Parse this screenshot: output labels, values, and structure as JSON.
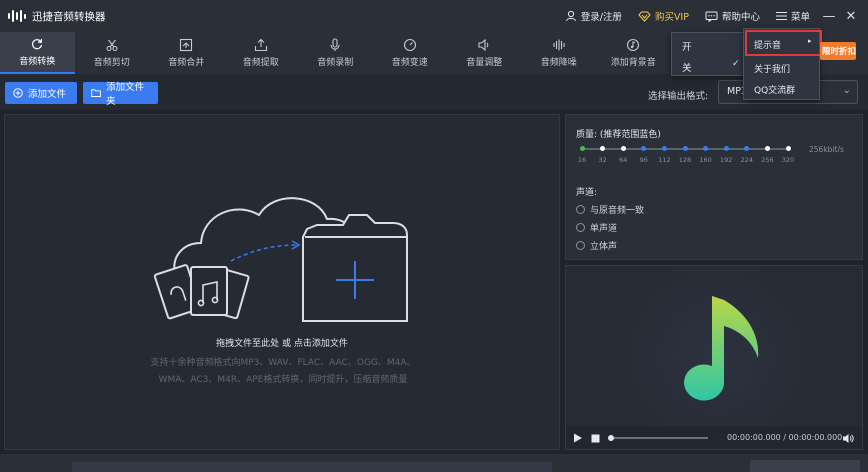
{
  "app": {
    "title": "迅捷音频转换器"
  },
  "titlebar": {
    "login": "登录/注册",
    "vip": "购买VIP",
    "help": "帮助中心",
    "menu": "菜单",
    "minimize": "—",
    "close": "✕"
  },
  "toolbar": {
    "tools": [
      {
        "label": "音频转换",
        "icon": "refresh-icon",
        "active": true
      },
      {
        "label": "音频剪切",
        "icon": "scissors-icon"
      },
      {
        "label": "音频合并",
        "icon": "merge-icon"
      },
      {
        "label": "音频提取",
        "icon": "extract-icon"
      },
      {
        "label": "音频录制",
        "icon": "microphone-icon"
      },
      {
        "label": "音频变速",
        "icon": "speed-icon"
      },
      {
        "label": "音量调整",
        "icon": "volume-icon"
      },
      {
        "label": "音频降噪",
        "icon": "noise-reduce-icon"
      },
      {
        "label": "添加背景音",
        "icon": "music-note-icon"
      }
    ]
  },
  "actions": {
    "add_file": "添加文件",
    "add_folder": "添加文件夹",
    "output_label": "选择输出格式:",
    "output_value": "MP3"
  },
  "dropzone": {
    "main": "拖拽文件至此处 或 点击添加文件",
    "sub_line1": "支持十余种音频格式向MP3、WAV、FLAC、AAC、OGG、M4A、",
    "sub_line2": "WMA、AC3、M4R、APE格式转换，同时提升，压缩音频质量"
  },
  "quality": {
    "title": "质量: (推荐范围蓝色)",
    "values": [
      "16",
      "32",
      "64",
      "96",
      "112",
      "128",
      "160",
      "192",
      "224",
      "256",
      "320"
    ],
    "max_label": "256kbit/s",
    "selected": "320"
  },
  "channel": {
    "title": "声道:",
    "options": [
      "与原音频一致",
      "单声道",
      "立体声"
    ]
  },
  "preview": {
    "time": "00:00:00.000 / 00:00:00.000"
  },
  "menus": {
    "sound_menu": {
      "on": "开",
      "off": "关"
    },
    "main_menu": {
      "items": [
        "提示音",
        "关于我们",
        "QQ交流群"
      ]
    },
    "promo": "限时折扣"
  },
  "colors": {
    "accent": "#3a7bf0",
    "highlight": "#e03b3b",
    "vip": "#f5c542",
    "promo": "#f27a2b"
  }
}
